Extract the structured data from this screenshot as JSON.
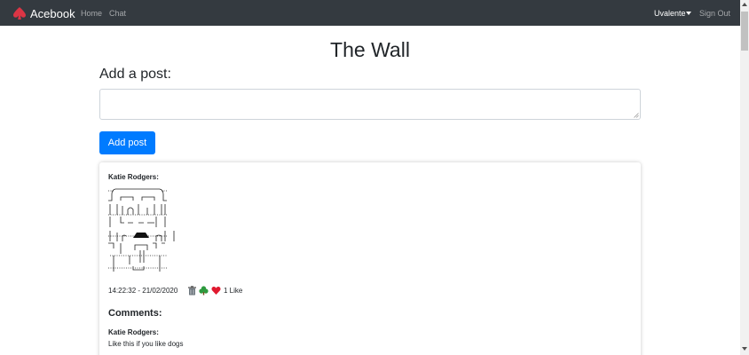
{
  "colors": {
    "navbar": "#343a40",
    "primary": "#007bff",
    "brand_icon": "#dc3545",
    "heart": "#e0192f",
    "tree": "#2e9a3e"
  },
  "navbar": {
    "brand": "Acebook",
    "brand_icon": "spade-icon",
    "links": [
      "Home",
      "Chat"
    ],
    "user": "Uvalente",
    "sign_out": "Sign Out"
  },
  "main": {
    "title": "The Wall",
    "add_label": "Add a post:",
    "post_input_value": "",
    "add_button": "Add post"
  },
  "post": {
    "author": "Katie Rodgers:",
    "ascii_art": "ascii-art-image",
    "timestamp": "14:22:32 - 21/02/2020",
    "icons": [
      "trash-icon",
      "tree-icon",
      "heart-icon"
    ],
    "likes": "1 Like"
  },
  "comments": {
    "heading": "Comments:",
    "items": [
      {
        "author": "Katie Rodgers:",
        "text": "Like this if you like dogs"
      }
    ]
  }
}
